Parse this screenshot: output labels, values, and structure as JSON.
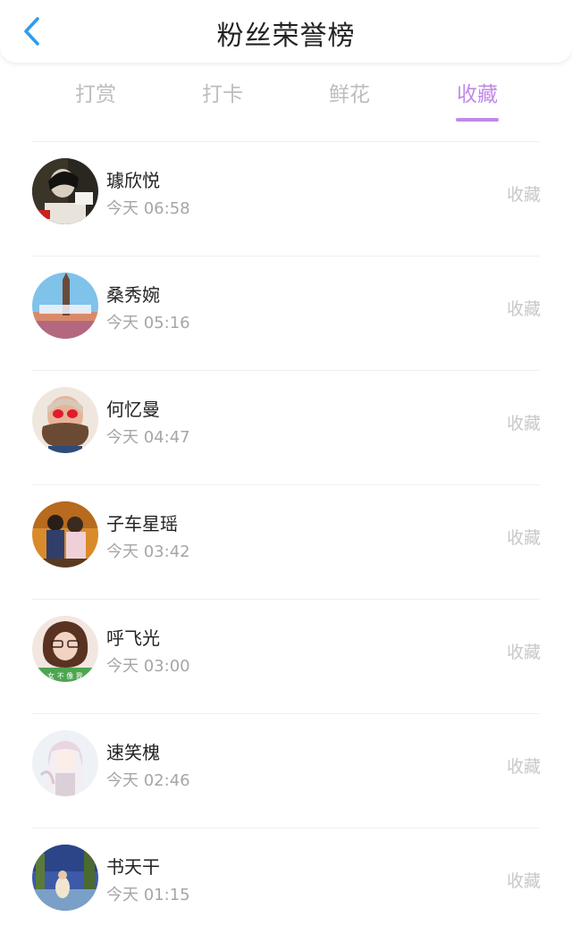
{
  "header": {
    "title": "粉丝荣誉榜",
    "back_icon": "chevron-left-icon",
    "back_color": "#2d9cf0"
  },
  "tabs": [
    {
      "label": "打赏",
      "active": false
    },
    {
      "label": "打卡",
      "active": false
    },
    {
      "label": "鲜花",
      "active": false
    },
    {
      "label": "收藏",
      "active": true
    }
  ],
  "accent_color": "#c08ae6",
  "list": [
    {
      "name": "璩欣悦",
      "time": "今天 06:58",
      "action": "收藏"
    },
    {
      "name": "桑秀婉",
      "time": "今天 05:16",
      "action": "收藏"
    },
    {
      "name": "何忆曼",
      "time": "今天 04:47",
      "action": "收藏"
    },
    {
      "name": "子车星瑶",
      "time": "今天 03:42",
      "action": "收藏"
    },
    {
      "name": "呼飞光",
      "time": "今天 03:00",
      "action": "收藏"
    },
    {
      "name": "速笑槐",
      "time": "今天 02:46",
      "action": "收藏"
    },
    {
      "name": "书天干",
      "time": "今天 01:15",
      "action": "收藏"
    }
  ],
  "avatar_text": {
    "hufeiguang": "女 不 像 我"
  }
}
